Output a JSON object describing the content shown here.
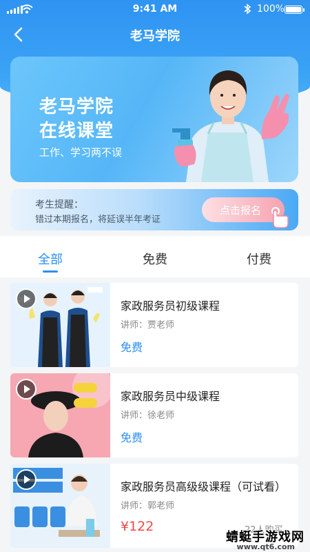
{
  "status_bar": {
    "time": "9:41 AM",
    "battery": "100%"
  },
  "nav": {
    "title": "老马学院"
  },
  "banner": {
    "title_line1": "老马学院",
    "title_line2": "在线课堂",
    "subtitle": "工作、学习两不误"
  },
  "reminder": {
    "label": "考生提醒：",
    "text": "错过本期报名，将延误半年考证",
    "button": "点击报名"
  },
  "tabs": [
    {
      "label": "全部",
      "active": true
    },
    {
      "label": "免费",
      "active": false
    },
    {
      "label": "付费",
      "active": false
    }
  ],
  "courses": [
    {
      "title": "家政服务员初级课程",
      "teacher": "讲师：贾老师",
      "price": "免费",
      "thumb_color": "#dcefff"
    },
    {
      "title": "家政服务员中级课程",
      "teacher": "讲师：徐老师",
      "price": "免费",
      "thumb_color": "#f7a9b4"
    },
    {
      "title": "家政服务员高级级课程（可试看）",
      "teacher": "讲师：郭老师",
      "price": "¥122",
      "buyers": "22人购买",
      "thumb_color": "#e8f2fb"
    }
  ],
  "watermark": {
    "line1": "蜻蜓手游戏网",
    "line2": "www.qt6.com"
  },
  "colors": {
    "primary": "#2b8ff0",
    "price_red": "#ef4a4a",
    "header": "#2f93f2"
  }
}
